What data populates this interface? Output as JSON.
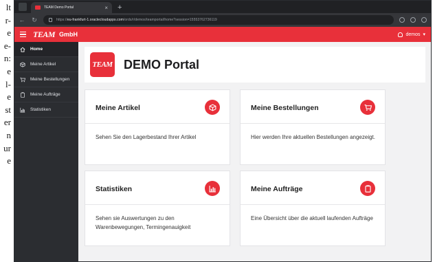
{
  "page_text": {
    "lines": [
      "lt",
      "r-",
      "e",
      "e-",
      "n:",
      "e",
      "l-",
      "e",
      "st",
      "er",
      "n",
      "ur",
      "e"
    ]
  },
  "browser": {
    "tab_title": "TEAM Demo Portal",
    "url_prefix": "https://",
    "url_host": "eu-frankfurt-1.oraclecloudapps.com",
    "url_path": "/ords/r/demos/teamportal/home?session=15553762736119"
  },
  "app": {
    "brand_logo": "TEAM",
    "brand_name": "GmbH",
    "user": "demos",
    "accent": "#e8303a"
  },
  "sidebar": {
    "items": [
      {
        "label": "Home",
        "icon": "home-icon"
      },
      {
        "label": "Meine Artikel",
        "icon": "box-icon"
      },
      {
        "label": "Meine Bestellungen",
        "icon": "cart-icon"
      },
      {
        "label": "Meine Aufträge",
        "icon": "clipboard-icon"
      },
      {
        "label": "Statistiken",
        "icon": "chart-icon"
      }
    ]
  },
  "portal": {
    "logo": "TEAM",
    "title": "DEMO Portal"
  },
  "cards": [
    {
      "title": "Meine Artikel",
      "text": "Sehen Sie den Lagerbestand Ihrer Artikel",
      "icon": "box-icon"
    },
    {
      "title": "Meine Bestellungen",
      "text": "Hier werden Ihre aktuellen Bestellungen angezeigt.",
      "icon": "cart-icon"
    },
    {
      "title": "Statistiken",
      "text": "Sehen sie Auswertungen zu den Warenbewegungen, Termingenauigkeit",
      "icon": "chart-icon"
    },
    {
      "title": "Meine Aufträge",
      "text": "Eine Übersicht über die aktuell laufenden Aufträge",
      "icon": "clipboard-icon"
    }
  ]
}
